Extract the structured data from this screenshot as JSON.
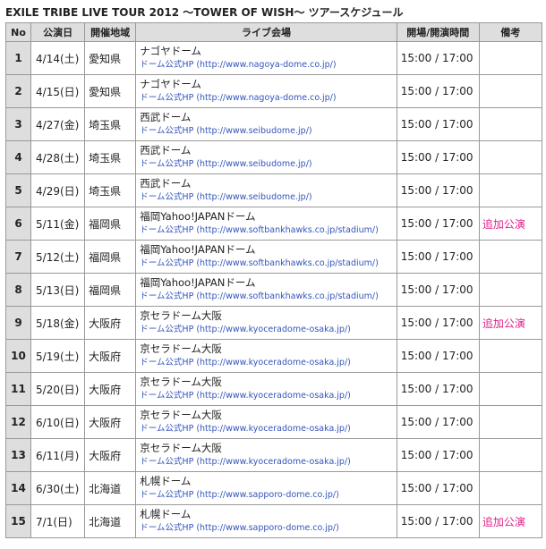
{
  "title": "EXILE TRIBE LIVE TOUR 2012 〜TOWER OF WISH〜 ツアースケジュール",
  "headers": {
    "no": "No",
    "date": "公演日",
    "region": "開催地域",
    "venue": "ライブ会場",
    "time": "開場/開演時間",
    "note": "備考"
  },
  "rows": [
    {
      "no": "1",
      "date": "4/14(土)",
      "region": "愛知県",
      "venue": "ナゴヤドーム",
      "link": "ドーム公式HP (http://www.nagoya-dome.co.jp/)",
      "time": "15:00 / 17:00",
      "note": ""
    },
    {
      "no": "2",
      "date": "4/15(日)",
      "region": "愛知県",
      "venue": "ナゴヤドーム",
      "link": "ドーム公式HP (http://www.nagoya-dome.co.jp/)",
      "time": "15:00 / 17:00",
      "note": ""
    },
    {
      "no": "3",
      "date": "4/27(金)",
      "region": "埼玉県",
      "venue": "西武ドーム",
      "link": "ドーム公式HP (http://www.seibudome.jp/)",
      "time": "15:00 / 17:00",
      "note": ""
    },
    {
      "no": "4",
      "date": "4/28(土)",
      "region": "埼玉県",
      "venue": "西武ドーム",
      "link": "ドーム公式HP (http://www.seibudome.jp/)",
      "time": "15:00 / 17:00",
      "note": ""
    },
    {
      "no": "5",
      "date": "4/29(日)",
      "region": "埼玉県",
      "venue": "西武ドーム",
      "link": "ドーム公式HP (http://www.seibudome.jp/)",
      "time": "15:00 / 17:00",
      "note": ""
    },
    {
      "no": "6",
      "date": "5/11(金)",
      "region": "福岡県",
      "venue": "福岡Yahoo!JAPANドーム",
      "link": "ドーム公式HP (http://www.softbankhawks.co.jp/stadium/)",
      "time": "15:00 / 17:00",
      "note": "追加公演"
    },
    {
      "no": "7",
      "date": "5/12(土)",
      "region": "福岡県",
      "venue": "福岡Yahoo!JAPANドーム",
      "link": "ドーム公式HP (http://www.softbankhawks.co.jp/stadium/)",
      "time": "15:00 / 17:00",
      "note": ""
    },
    {
      "no": "8",
      "date": "5/13(日)",
      "region": "福岡県",
      "venue": "福岡Yahoo!JAPANドーム",
      "link": "ドーム公式HP (http://www.softbankhawks.co.jp/stadium/)",
      "time": "15:00 / 17:00",
      "note": ""
    },
    {
      "no": "9",
      "date": "5/18(金)",
      "region": "大阪府",
      "venue": "京セラドーム大阪",
      "link": "ドーム公式HP (http://www.kyoceradome-osaka.jp/)",
      "time": "15:00 / 17:00",
      "note": "追加公演"
    },
    {
      "no": "10",
      "date": "5/19(土)",
      "region": "大阪府",
      "venue": "京セラドーム大阪",
      "link": "ドーム公式HP (http://www.kyoceradome-osaka.jp/)",
      "time": "15:00 / 17:00",
      "note": ""
    },
    {
      "no": "11",
      "date": "5/20(日)",
      "region": "大阪府",
      "venue": "京セラドーム大阪",
      "link": "ドーム公式HP (http://www.kyoceradome-osaka.jp/)",
      "time": "15:00 / 17:00",
      "note": ""
    },
    {
      "no": "12",
      "date": "6/10(日)",
      "region": "大阪府",
      "venue": "京セラドーム大阪",
      "link": "ドーム公式HP (http://www.kyoceradome-osaka.jp/)",
      "time": "15:00 / 17:00",
      "note": ""
    },
    {
      "no": "13",
      "date": "6/11(月)",
      "region": "大阪府",
      "venue": "京セラドーム大阪",
      "link": "ドーム公式HP (http://www.kyoceradome-osaka.jp/)",
      "time": "15:00 / 17:00",
      "note": ""
    },
    {
      "no": "14",
      "date": "6/30(土)",
      "region": "北海道",
      "venue": "札幌ドーム",
      "link": "ドーム公式HP (http://www.sapporo-dome.co.jp/)",
      "time": "15:00 / 17:00",
      "note": ""
    },
    {
      "no": "15",
      "date": "7/1(日)",
      "region": "北海道",
      "venue": "札幌ドーム",
      "link": "ドーム公式HP (http://www.sapporo-dome.co.jp/)",
      "time": "15:00 / 17:00",
      "note": "追加公演"
    }
  ],
  "colors": {
    "header_bg": "#dedede",
    "border": "#999999",
    "link": "#3355bb",
    "note": "#e0218a"
  }
}
